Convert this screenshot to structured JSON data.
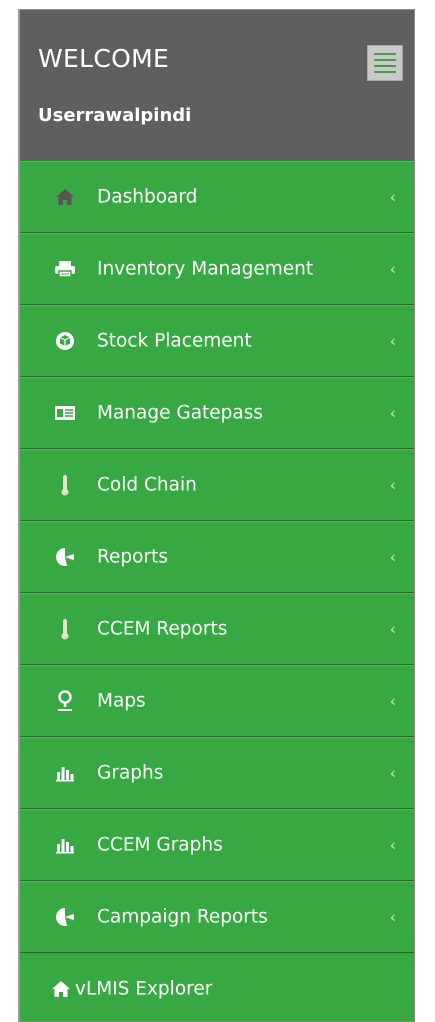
{
  "header": {
    "welcome": "WELCOME",
    "username": "Userrawalpindi"
  },
  "menu": {
    "items": [
      {
        "label": "Dashboard",
        "icon": "home-icon"
      },
      {
        "label": "Inventory Management",
        "icon": "printer-icon"
      },
      {
        "label": "Stock Placement",
        "icon": "cube-icon"
      },
      {
        "label": "Manage Gatepass",
        "icon": "id-card-icon"
      },
      {
        "label": "Cold Chain",
        "icon": "thermometer-icon"
      },
      {
        "label": "Reports",
        "icon": "pie-chart-icon"
      },
      {
        "label": "CCEM Reports",
        "icon": "thermometer-icon"
      },
      {
        "label": "Maps",
        "icon": "map-marker-icon"
      },
      {
        "label": "Graphs",
        "icon": "bar-chart-icon"
      },
      {
        "label": "CCEM Graphs",
        "icon": "bar-chart-icon"
      },
      {
        "label": "Campaign Reports",
        "icon": "pie-chart-icon"
      }
    ],
    "chevron": "‹",
    "explorer_label": "vLMIS Explorer"
  },
  "colors": {
    "sidebar_green": "#38a843",
    "header_gray": "#5f5f5f"
  }
}
